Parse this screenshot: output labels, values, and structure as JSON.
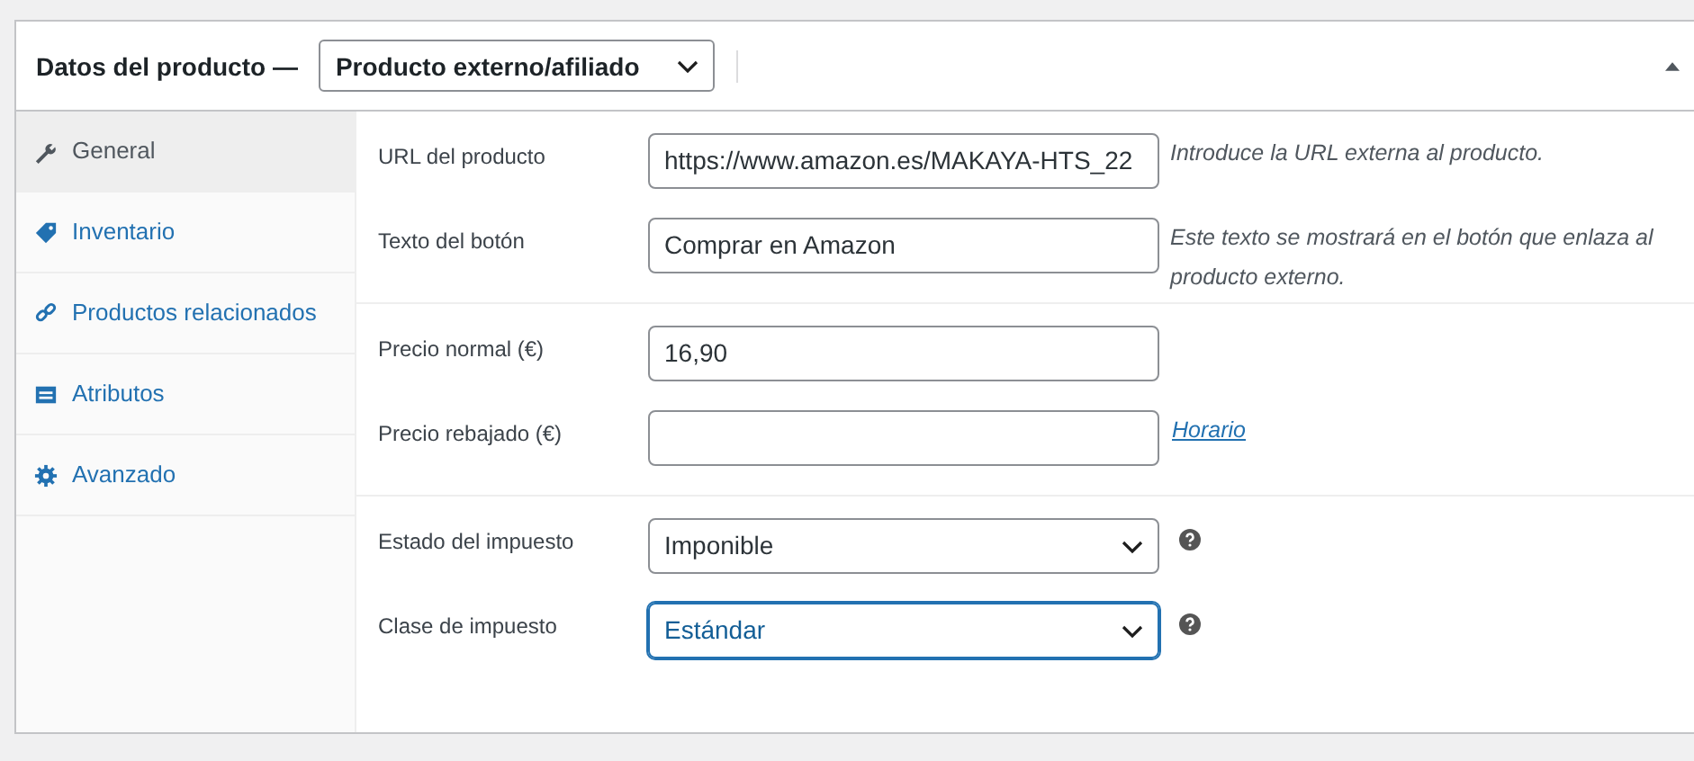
{
  "header": {
    "title": "Datos del producto —",
    "product_type": "Producto externo/afiliado"
  },
  "tabs": [
    {
      "label": "General",
      "selected": true
    },
    {
      "label": "Inventario",
      "selected": false
    },
    {
      "label": "Productos relacionados",
      "selected": false
    },
    {
      "label": "Atributos",
      "selected": false
    },
    {
      "label": "Avanzado",
      "selected": false
    }
  ],
  "sections": [
    {
      "fields": [
        {
          "label": "URL del producto",
          "kind": "text",
          "value": "https://www.amazon.es/MAKAYA-HTS_22",
          "description": "Introduce la URL externa al producto."
        },
        {
          "label": "Texto del botón",
          "kind": "text",
          "value": "Comprar en Amazon",
          "description": "Este texto se mostrará en el botón que enlaza al producto externo."
        }
      ]
    },
    {
      "fields": [
        {
          "label": "Precio normal (€)",
          "kind": "text",
          "value": "16,90"
        },
        {
          "label": "Precio rebajado (€)",
          "kind": "text",
          "link": "Horario"
        }
      ]
    },
    {
      "fields": [
        {
          "label": "Estado del impuesto",
          "kind": "select",
          "value": "Imponible",
          "focused": false,
          "help_icon": true
        },
        {
          "label": "Clase de impuesto",
          "kind": "select",
          "value": "Estándar",
          "focused": true,
          "help_icon": true
        }
      ]
    }
  ]
}
